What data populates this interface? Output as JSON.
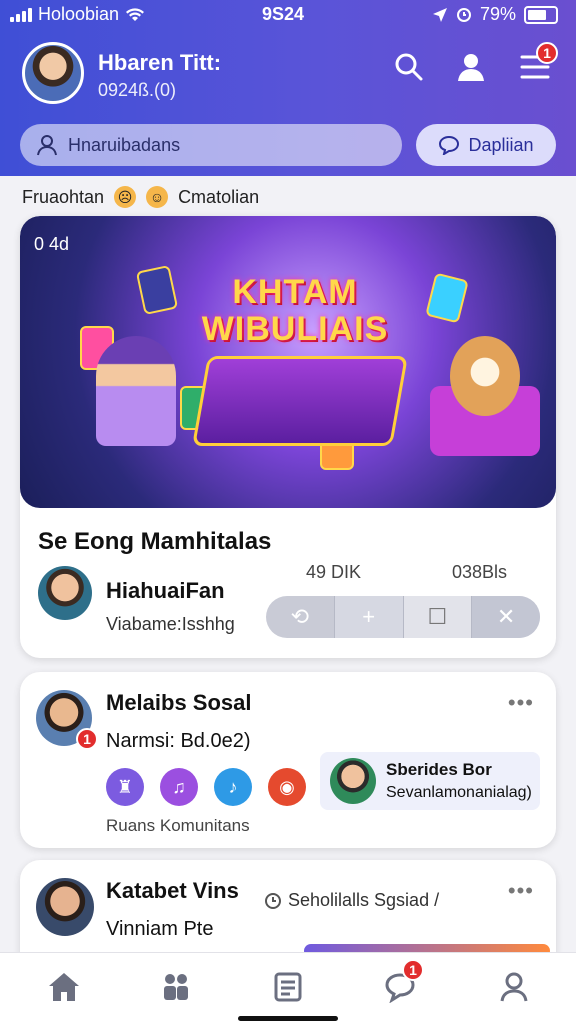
{
  "status_bar": {
    "carrier": "Holoobian",
    "time": "9S24",
    "battery": "79%"
  },
  "header": {
    "user_name": "Hbaren Titt:",
    "user_sub": "0924ß.(0)",
    "notification_count": "1"
  },
  "search": {
    "placeholder": "Hnaruibadans",
    "button_label": "Dapliian"
  },
  "section": {
    "label_left": "Fruaohtan",
    "label_right": "Cmatolian"
  },
  "post1": {
    "hero_time": "0 4d",
    "hero_title_line1": "KHTAM",
    "hero_title_line2": "WIBULIAIS",
    "title": "Se Eong Mamhitalas",
    "author": "HiahuaiFan",
    "meta": "Viabame:Isshhg",
    "stat1": "49 DIK",
    "stat2": "038Bls",
    "tools": [
      "⟲",
      "+",
      "☐",
      "✕"
    ]
  },
  "post2": {
    "title": "Melaibs Sosal",
    "subtitle": "Narmsi: Bd.0e2)",
    "more": "•••",
    "footer": "Ruans Komunitans",
    "share_title": "Sberides Bor",
    "share_sub": "Sevanlamonanialag)",
    "badge": "1"
  },
  "post3": {
    "title": "Katabet Vins",
    "meta": "Seholilalls Sgsiad /",
    "subtitle": "Vinniam Pte",
    "more": "•••"
  },
  "nav": {
    "messages_badge": "1"
  },
  "colors": {
    "header_start": "#3f4fd6",
    "header_end": "#6a4fd0",
    "badge": "#e22d2d",
    "accent": "#5a54d8"
  }
}
